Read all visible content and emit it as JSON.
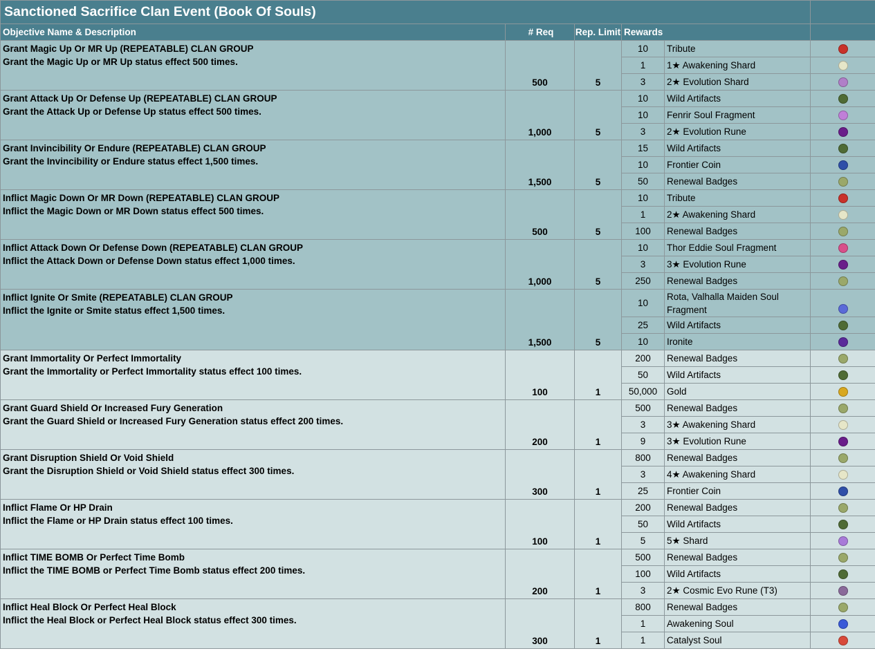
{
  "title": "Sanctioned Sacrifice Clan Event (Book Of Souls)",
  "headers": {
    "objective": "Objective Name & Description",
    "req": "# Req",
    "rep_limit": "Rep. Limit",
    "rewards": "Rewards"
  },
  "icon_colors": {
    "tribute-icon": "#c8322a",
    "awakening-shard-icon": "#e6e6c8",
    "evolution-shard-icon": "#b07fc8",
    "wild-artifacts-icon": "#4f6b35",
    "fenrir-soul-fragment-icon": "#c07fd8",
    "evolution-rune-icon": "#6a1e8a",
    "frontier-coin-icon": "#2f4fa8",
    "renewal-badges-icon": "#9aa86a",
    "thor-eddie-soul-fragment-icon": "#d8508a",
    "rota-soul-fragment-icon": "#5a6ad8",
    "ironite-icon": "#5a2a9a",
    "gold-icon": "#d8a820",
    "shard-icon": "#a87ad8",
    "cosmic-evo-rune-icon": "#8a6a9a",
    "awakening-soul-icon": "#3a5ad8",
    "catalyst-soul-icon": "#d84a3a"
  },
  "objectives": [
    {
      "name": "Grant Magic Up Or MR Up (REPEATABLE) CLAN GROUP",
      "description": "Grant the Magic Up or MR Up status effect 500 times.",
      "req": "500",
      "rep_limit": "5",
      "repeatable": true,
      "rewards": [
        {
          "qty": "10",
          "name": "Tribute",
          "icon": "tribute-icon"
        },
        {
          "qty": "1",
          "name": "1★ Awakening Shard",
          "icon": "awakening-shard-icon"
        },
        {
          "qty": "3",
          "name": "2★ Evolution Shard",
          "icon": "evolution-shard-icon"
        }
      ]
    },
    {
      "name": "Grant Attack Up Or Defense Up (REPEATABLE) CLAN GROUP",
      "description": "Grant the Attack Up or Defense Up status effect 500 times.",
      "req": "1,000",
      "rep_limit": "5",
      "repeatable": true,
      "rewards": [
        {
          "qty": "10",
          "name": "Wild Artifacts",
          "icon": "wild-artifacts-icon"
        },
        {
          "qty": "10",
          "name": "Fenrir Soul Fragment",
          "icon": "fenrir-soul-fragment-icon"
        },
        {
          "qty": "3",
          "name": "2★ Evolution Rune",
          "icon": "evolution-rune-icon"
        }
      ]
    },
    {
      "name": "Grant Invincibility Or Endure (REPEATABLE) CLAN GROUP",
      "description": "Grant the Invincibility or Endure status effect 1,500 times.",
      "req": "1,500",
      "rep_limit": "5",
      "repeatable": true,
      "rewards": [
        {
          "qty": "15",
          "name": "Wild Artifacts",
          "icon": "wild-artifacts-icon"
        },
        {
          "qty": "10",
          "name": "Frontier Coin",
          "icon": "frontier-coin-icon"
        },
        {
          "qty": "50",
          "name": "Renewal Badges",
          "icon": "renewal-badges-icon"
        }
      ]
    },
    {
      "name": "Inflict Magic Down Or MR Down (REPEATABLE) CLAN GROUP",
      "description": "Inflict the Magic Down or MR Down status effect 500 times.",
      "req": "500",
      "rep_limit": "5",
      "repeatable": true,
      "rewards": [
        {
          "qty": "10",
          "name": "Tribute",
          "icon": "tribute-icon"
        },
        {
          "qty": "1",
          "name": "2★ Awakening Shard",
          "icon": "awakening-shard-icon"
        },
        {
          "qty": "100",
          "name": "Renewal Badges",
          "icon": "renewal-badges-icon"
        }
      ]
    },
    {
      "name": "Inflict Attack Down Or Defense Down (REPEATABLE) CLAN GROUP",
      "description": "Inflict the Attack Down or Defense Down status effect 1,000 times.",
      "req": "1,000",
      "rep_limit": "5",
      "repeatable": true,
      "rewards": [
        {
          "qty": "10",
          "name": "Thor Eddie Soul Fragment",
          "icon": "thor-eddie-soul-fragment-icon"
        },
        {
          "qty": "3",
          "name": "3★ Evolution Rune",
          "icon": "evolution-rune-icon"
        },
        {
          "qty": "250",
          "name": "Renewal Badges",
          "icon": "renewal-badges-icon"
        }
      ]
    },
    {
      "name": "Inflict Ignite Or Smite (REPEATABLE) CLAN GROUP",
      "description": "Inflict the Ignite or Smite status effect 1,500 times.",
      "req": "1,500",
      "rep_limit": "5",
      "repeatable": true,
      "rewards": [
        {
          "qty": "10",
          "name": "Rota, Valhalla Maiden Soul Fragment",
          "icon": "rota-soul-fragment-icon",
          "tall": true
        },
        {
          "qty": "25",
          "name": "Wild Artifacts",
          "icon": "wild-artifacts-icon"
        },
        {
          "qty": "10",
          "name": "Ironite",
          "icon": "ironite-icon"
        }
      ]
    },
    {
      "name": "Grant Immortality Or Perfect Immortality",
      "description": "Grant the Immortality or Perfect Immortality status effect 100 times.",
      "req": "100",
      "rep_limit": "1",
      "repeatable": false,
      "rewards": [
        {
          "qty": "200",
          "name": "Renewal Badges",
          "icon": "renewal-badges-icon"
        },
        {
          "qty": "50",
          "name": "Wild Artifacts",
          "icon": "wild-artifacts-icon"
        },
        {
          "qty": "50,000",
          "name": "Gold",
          "icon": "gold-icon"
        }
      ]
    },
    {
      "name": "Grant Guard Shield Or Increased Fury Generation",
      "description": "Grant the Guard Shield or Increased Fury Generation status effect 200 times.",
      "req": "200",
      "rep_limit": "1",
      "repeatable": false,
      "rewards": [
        {
          "qty": "500",
          "name": "Renewal Badges",
          "icon": "renewal-badges-icon"
        },
        {
          "qty": "3",
          "name": "3★ Awakening Shard",
          "icon": "awakening-shard-icon"
        },
        {
          "qty": "9",
          "name": "3★ Evolution Rune",
          "icon": "evolution-rune-icon"
        }
      ]
    },
    {
      "name": "Grant Disruption Shield Or Void Shield",
      "description": "Grant the Disruption Shield or Void Shield status effect 300 times.",
      "req": "300",
      "rep_limit": "1",
      "repeatable": false,
      "rewards": [
        {
          "qty": "800",
          "name": "Renewal Badges",
          "icon": "renewal-badges-icon"
        },
        {
          "qty": "3",
          "name": "4★ Awakening Shard",
          "icon": "awakening-shard-icon"
        },
        {
          "qty": "25",
          "name": "Frontier Coin",
          "icon": "frontier-coin-icon"
        }
      ]
    },
    {
      "name": "Inflict Flame Or HP Drain",
      "description": "Inflict the Flame or HP Drain status effect 100 times.",
      "req": "100",
      "rep_limit": "1",
      "repeatable": false,
      "rewards": [
        {
          "qty": "200",
          "name": "Renewal Badges",
          "icon": "renewal-badges-icon"
        },
        {
          "qty": "50",
          "name": "Wild Artifacts",
          "icon": "wild-artifacts-icon"
        },
        {
          "qty": "5",
          "name": "5★ Shard",
          "icon": "shard-icon"
        }
      ]
    },
    {
      "name": "Inflict TIME BOMB Or Perfect Time Bomb",
      "description": "Inflict the TIME BOMB or Perfect Time Bomb status effect 200 times.",
      "req": "200",
      "rep_limit": "1",
      "repeatable": false,
      "rewards": [
        {
          "qty": "500",
          "name": "Renewal Badges",
          "icon": "renewal-badges-icon"
        },
        {
          "qty": "100",
          "name": "Wild Artifacts",
          "icon": "wild-artifacts-icon"
        },
        {
          "qty": "3",
          "name": "2★ Cosmic Evo Rune (T3)",
          "icon": "cosmic-evo-rune-icon"
        }
      ]
    },
    {
      "name": "Inflict Heal Block Or Perfect Heal Block",
      "description": "Inflict the Heal Block or Perfect Heal Block status effect 300 times.",
      "req": "300",
      "rep_limit": "1",
      "repeatable": false,
      "rewards": [
        {
          "qty": "800",
          "name": "Renewal Badges",
          "icon": "renewal-badges-icon"
        },
        {
          "qty": "1",
          "name": "Awakening Soul",
          "icon": "awakening-soul-icon"
        },
        {
          "qty": "1",
          "name": "Catalyst Soul",
          "icon": "catalyst-soul-icon"
        }
      ]
    }
  ]
}
